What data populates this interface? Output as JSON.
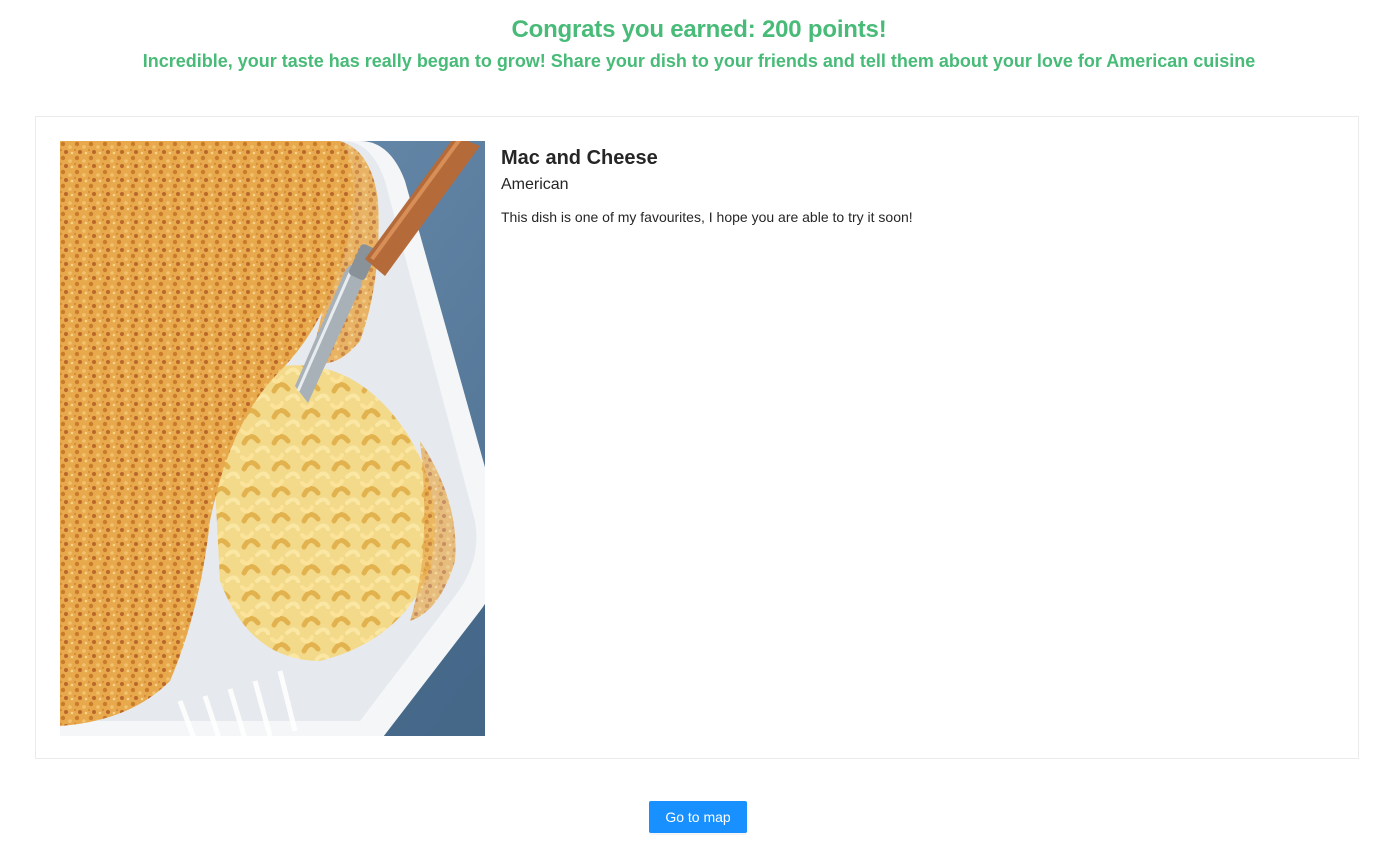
{
  "header": {
    "title": "Congrats you earned: 200 points!",
    "subtitle": "Incredible, your taste has really began to grow! Share your dish to your friends and tell them about your love for American cuisine"
  },
  "dish": {
    "name": "Mac and Cheese",
    "cuisine": "American",
    "description": "This dish is one of my favourites, I hope you are able to try it soon!",
    "image_icon": "mac-and-cheese-photo"
  },
  "actions": {
    "map_button_label": "Go to map"
  },
  "colors": {
    "accent_green": "#48bb78",
    "primary_blue": "#1890ff",
    "card_border": "#ebebeb"
  }
}
